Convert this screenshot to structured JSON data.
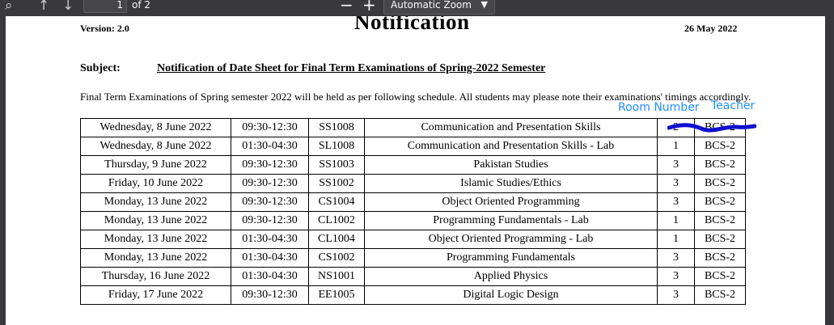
{
  "toolbar": {
    "page_number": "1",
    "page_total": "of 2",
    "zoom_out": "−",
    "zoom_in": "+",
    "zoom_label": "Automatic Zoom",
    "icons": [
      "search-icon",
      "arrow-up-icon",
      "arrow-down-icon",
      "chevron-down-icon"
    ]
  },
  "document": {
    "version": "Version: 2.0",
    "title": "Notification",
    "date": "26 May 2022",
    "subject_label": "Subject:",
    "subject_text": "Notification of Date Sheet for Final Term Examinations of Spring-2022 Semester",
    "intro": "Final Term Examinations of Spring semester 2022 will be held as per following schedule. All students may please note their examinations' timings accordingly."
  },
  "annotations": {
    "room_number": "Room Number",
    "teacher": "Teacher",
    "color": "#1e90ff",
    "scribble_color": "#1010d0"
  },
  "schedule": [
    {
      "date": "Wednesday, 8 June 2022",
      "time": "09:30-12:30",
      "code": "SS1008",
      "course": "Communication and Presentation Skills",
      "room": "2",
      "cls": "BCS-2"
    },
    {
      "date": "Wednesday, 8 June 2022",
      "time": "01:30-04:30",
      "code": "SL1008",
      "course": "Communication and Presentation Skills - Lab",
      "room": "1",
      "cls": "BCS-2"
    },
    {
      "date": "Thursday, 9 June 2022",
      "time": "09:30-12:30",
      "code": "SS1003",
      "course": "Pakistan Studies",
      "room": "3",
      "cls": "BCS-2"
    },
    {
      "date": "Friday, 10 June 2022",
      "time": "09:30-12:30",
      "code": "SS1002",
      "course": "Islamic Studies/Ethics",
      "room": "3",
      "cls": "BCS-2"
    },
    {
      "date": "Monday, 13 June 2022",
      "time": "09:30-12:30",
      "code": "CS1004",
      "course": "Object Oriented Programming",
      "room": "3",
      "cls": "BCS-2"
    },
    {
      "date": "Monday, 13 June 2022",
      "time": "09:30-12:30",
      "code": "CL1002",
      "course": "Programming Fundamentals - Lab",
      "room": "1",
      "cls": "BCS-2"
    },
    {
      "date": "Monday, 13 June 2022",
      "time": "01:30-04:30",
      "code": "CL1004",
      "course": "Object Oriented Programming - Lab",
      "room": "1",
      "cls": "BCS-2"
    },
    {
      "date": "Monday, 13 June 2022",
      "time": "01:30-04:30",
      "code": "CS1002",
      "course": "Programming Fundamentals",
      "room": "3",
      "cls": "BCS-2"
    },
    {
      "date": "Thursday, 16 June 2022",
      "time": "01:30-04:30",
      "code": "NS1001",
      "course": "Applied Physics",
      "room": "3",
      "cls": "BCS-2"
    },
    {
      "date": "Friday, 17 June 2022",
      "time": "09:30-12:30",
      "code": "EE1005",
      "course": "Digital Logic Design",
      "room": "3",
      "cls": "BCS-2"
    }
  ]
}
